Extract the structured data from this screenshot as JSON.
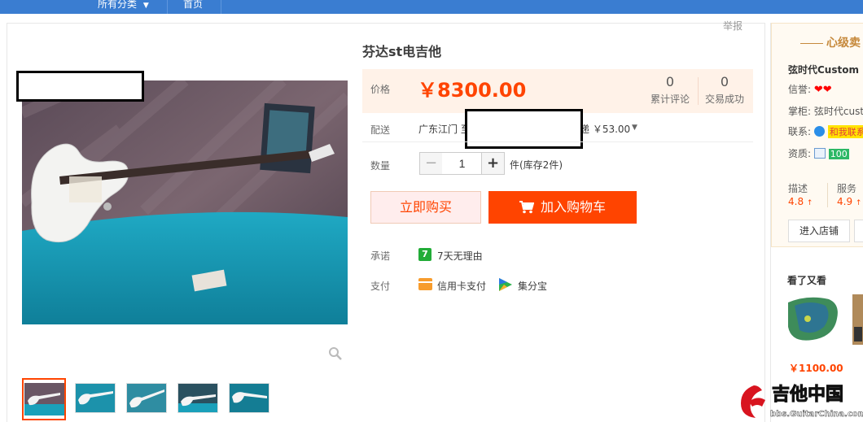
{
  "topnav": {
    "all_categories": "所有分类",
    "home": "首页"
  },
  "report": "举报",
  "product": {
    "title": "芬达st电吉他",
    "price_label": "价格",
    "price": "￥8300.00",
    "reviews_count": "0",
    "reviews_label": "累计评论",
    "deals_count": "0",
    "deals_label": "交易成功",
    "shipping_label": "配送",
    "shipping_origin": "广东江门 至",
    "shipping_fee": "递 ￥53.00",
    "quantity_label": "数量",
    "quantity_value": "1",
    "quantity_minus": "−",
    "quantity_plus": "+",
    "stock": "件(库存2件)",
    "buy_now": "立即购买",
    "add_to_cart": "加入购物车",
    "promise_label": "承诺",
    "promise_badge": "7",
    "promise_text": "7天无理由",
    "pay_label": "支付",
    "pay_card": "信用卡支付",
    "pay_jfb": "集分宝"
  },
  "seller": {
    "level": "心级卖",
    "shop_name": "弦时代Custom",
    "reputation_label": "信誉:",
    "manager_label": "掌柜:",
    "manager_name": "弦时代cust",
    "contact_label": "联系:",
    "contact_badge": "和我联系",
    "qualification_label": "资质:",
    "qualification_value": "100",
    "dsr_desc_label": "描述",
    "dsr_desc_value": "4.8",
    "dsr_service_label": "服务",
    "dsr_service_value": "4.9",
    "enter_shop": "进入店铺",
    "also_viewed_title": "看了又看",
    "also_viewed_price": "￥1100.00"
  },
  "colors": {
    "brand_blue": "#3a7dd1",
    "accent_orange": "#ff4400",
    "price_bg": "#fff2e8",
    "seller_gold": "#c6893c"
  },
  "watermark": {
    "title": "吉他中国",
    "url": "bbs.GuitarChina.com"
  }
}
